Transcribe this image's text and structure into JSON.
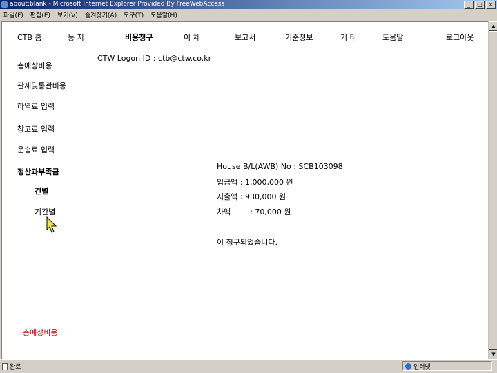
{
  "window": {
    "title": "about:blank - Microsoft Internet Explorer Provided By FreeWebAccess",
    "controls": [
      "_",
      "□",
      "×"
    ]
  },
  "menubar": [
    "파일(F)",
    "편집(E)",
    "보기(V)",
    "즐겨찾기(A)",
    "도구(T)",
    "도움말(H)"
  ],
  "topnav": [
    "CTB 홈",
    "등 지",
    "비용청구",
    "이 체",
    "보고서",
    "기준정보",
    "기 타",
    "도움말",
    "로그아웃"
  ],
  "sidebar": {
    "items": [
      "총예상비용",
      "관세및통관비용",
      "하역료 입력",
      "창고료 입력",
      "운송료 입력",
      "정산과부족금",
      "건별",
      "기간별"
    ],
    "bottom_link": "총예상비용"
  },
  "main": {
    "logon": "CTW Logon ID : ctb@ctw.co.kr",
    "house_bl": "House B/L(AWB) No : SCB103098",
    "deposit": "입금액 : 1,000,000 원",
    "expense": "지출액 : 930,000 원",
    "difference": "차액        : 70,000 원",
    "message": "이 청구되었습니다."
  },
  "status": {
    "left": "완료",
    "zone": "인터넷"
  },
  "colors": {
    "titlebar_start": "#0a246a",
    "titlebar_end": "#a6caf0",
    "link_red": "#d00000"
  }
}
